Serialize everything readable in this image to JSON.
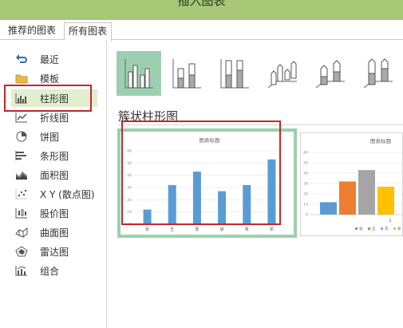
{
  "window": {
    "title": "插入图表"
  },
  "tabs": [
    {
      "label": "推荐的图表"
    },
    {
      "label": "所有图表"
    }
  ],
  "sidebar": {
    "items": [
      {
        "label": "最近",
        "icon": "undo-arrow-icon"
      },
      {
        "label": "模板",
        "icon": "folder-icon"
      },
      {
        "label": "柱形图",
        "icon": "column-chart-icon",
        "selected": true
      },
      {
        "label": "折线图",
        "icon": "line-chart-icon"
      },
      {
        "label": "饼图",
        "icon": "pie-chart-icon"
      },
      {
        "label": "条形图",
        "icon": "bar-chart-icon"
      },
      {
        "label": "面积图",
        "icon": "area-chart-icon"
      },
      {
        "label": "X Y (散点图)",
        "icon": "scatter-chart-icon"
      },
      {
        "label": "股价图",
        "icon": "stock-chart-icon"
      },
      {
        "label": "曲面图",
        "icon": "surface-chart-icon"
      },
      {
        "label": "雷达图",
        "icon": "radar-chart-icon"
      },
      {
        "label": "组合",
        "icon": "combo-chart-icon"
      }
    ]
  },
  "subtypes": [
    {
      "name": "clustered-column",
      "selected": true
    },
    {
      "name": "stacked-column"
    },
    {
      "name": "100-percent-stacked-column"
    },
    {
      "name": "3d-clustered-column"
    },
    {
      "name": "3d-stacked-column"
    },
    {
      "name": "3d-100-percent-stacked-column"
    }
  ],
  "section_title": "簇状柱形图",
  "colors": {
    "accent": "#9ccfb0",
    "titlebar": "#a7c777",
    "highlight_red": "#c3262b",
    "bar_blue": "#5b9bd5",
    "bar_orange": "#ed7d31",
    "bar_gray": "#a5a5a5",
    "bar_yellow": "#ffc000"
  },
  "preview1": {
    "title": "图表标题"
  },
  "preview2": {
    "title": "图表标题",
    "axis_label": "1"
  },
  "chart_data": [
    {
      "type": "bar",
      "title": "图表标题",
      "categories": [
        "张",
        "王",
        "李",
        "徐",
        "朱",
        "邓"
      ],
      "values": [
        12,
        32,
        43,
        27,
        32,
        53
      ],
      "ylim": [
        0,
        60
      ],
      "yticks": [
        0,
        10,
        20,
        30,
        40,
        50,
        60
      ],
      "grid": true
    },
    {
      "type": "bar",
      "title": "图表标题",
      "categories": [
        "1"
      ],
      "series": [
        {
          "name": "张",
          "values": [
            12
          ]
        },
        {
          "name": "王",
          "values": [
            32
          ]
        },
        {
          "name": "李",
          "values": [
            43
          ]
        },
        {
          "name": "徐",
          "values": [
            27
          ]
        }
      ],
      "ylim": [
        0,
        60
      ],
      "yticks": [
        0,
        10,
        20,
        30,
        40,
        50,
        60
      ],
      "grid": true,
      "legend": "bottom"
    }
  ]
}
